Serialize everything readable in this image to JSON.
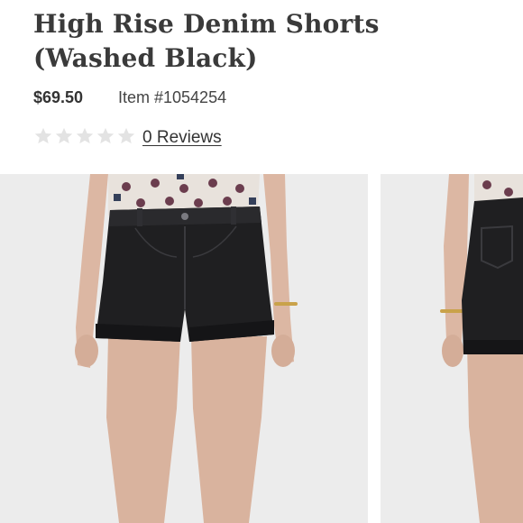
{
  "product": {
    "title": "High Rise Denim Shorts (Washed Black)",
    "price": "$69.50",
    "item_number": "Item #1054254",
    "rating": 0,
    "rating_max": 5,
    "reviews_link": "0 Reviews"
  },
  "gallery": {
    "images": [
      {
        "name": "front-view"
      },
      {
        "name": "side-view"
      }
    ]
  },
  "colors": {
    "background": "#ffffff",
    "photo_background": "#ececec",
    "star_empty": "#e3e3e3",
    "shorts": "#1f1f21",
    "skin": "#d9b39e"
  }
}
